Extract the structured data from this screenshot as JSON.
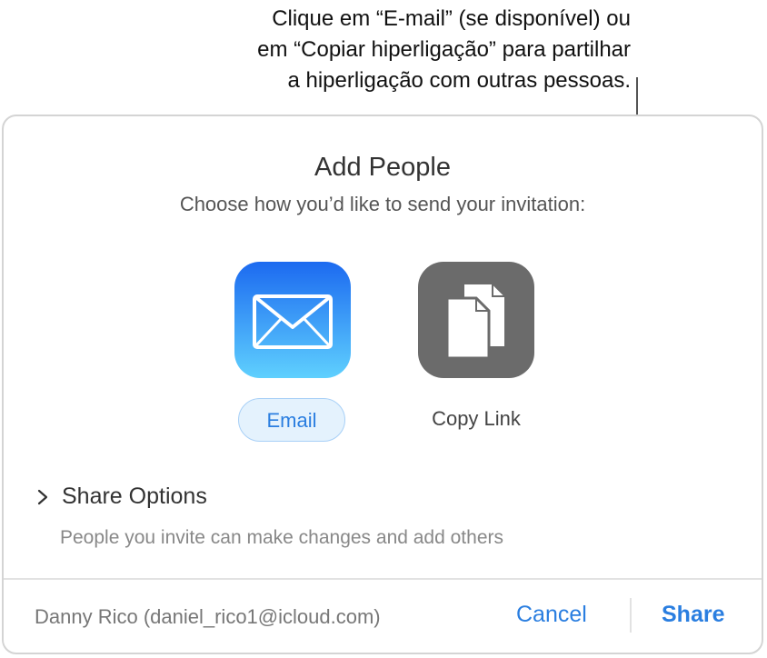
{
  "callout": {
    "lines": [
      "Clique em “E-mail” (se disponível) ou",
      "em “Copiar hiperligação” para partilhar",
      "a hiperligação com outras pessoas."
    ]
  },
  "dialog": {
    "title": "Add People",
    "subtitle": "Choose how you’d like to send your invitation:",
    "options": [
      {
        "label": "Email",
        "icon": "envelope-icon",
        "selected": true
      },
      {
        "label": "Copy Link",
        "icon": "copy-documents-icon",
        "selected": false
      }
    ],
    "share_options": {
      "label": "Share Options",
      "description": "People you invite can make changes and add others"
    },
    "footer": {
      "user": "Danny Rico (daniel_rico1@icloud.com)",
      "cancel_label": "Cancel",
      "share_label": "Share"
    }
  },
  "colors": {
    "accent": "#2a7ee0",
    "email_tile_top": "#1c6af0",
    "email_tile_bottom": "#5fd0fe",
    "copy_tile": "#6b6b6b"
  }
}
